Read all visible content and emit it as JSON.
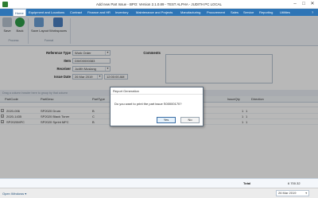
{
  "window": {
    "title": "Add new Part Issue - BPO: Version 2.1.0.89 - TEST ALPHA - JUDITH PC LOCAL",
    "minimize": "–",
    "maximize": "□",
    "close": "✕"
  },
  "menu": {
    "items": [
      "Home",
      "Equipment and Locations",
      "Contract",
      "Finance and HR",
      "Inventory",
      "Maintenance and Projects",
      "Manufacturing",
      "Procurement",
      "Sales",
      "Service",
      "Reporting",
      "Utilities"
    ],
    "help": "?"
  },
  "ribbon": {
    "save": "Save",
    "back": "Back",
    "save_layout": "Save Layout",
    "workspaces": "Workspaces",
    "group_process": "Process",
    "group_format": "Format"
  },
  "form": {
    "reference_type_label": "Reference Type",
    "reference_type_value": "Work Order",
    "item_label": "Item",
    "item_value": "DWO0000383",
    "receiver_label": "Receiver",
    "receiver_value": "Judith Muslang",
    "issue_date_label": "Issue Date",
    "issue_date_value": "26 Mar 2019",
    "issue_time_value": "12:00:00 AM",
    "comments_label": "Comments"
  },
  "grid": {
    "group_hint": "Drag a column header here to group by that column",
    "columns": [
      "PartCode",
      "PartDesc",
      "PartType",
      "IssueQty",
      "Direction"
    ],
    "rows": [
      {
        "code": "2020-006",
        "desc": "SP2020 Drum",
        "type": "B",
        "qty": "1",
        "dir": "1"
      },
      {
        "code": "2020-1435",
        "desc": "SP2020 Black Toner",
        "type": "C",
        "qty": "1",
        "dir": "1"
      },
      {
        "code": "SP2020MFC",
        "desc": "SP2020 Sprint MFC",
        "type": "B",
        "qty": "1",
        "dir": "1"
      }
    ]
  },
  "totals": {
    "label": "Total",
    "value": "6 700.32"
  },
  "status": {
    "open_windows": "Open Windows ▾",
    "date": "26 Mar 2019"
  },
  "dialog": {
    "title": "Report Generation",
    "message": "Do you want to print the part issue S00000170?",
    "yes": "Yes",
    "no": "No"
  },
  "colors": {
    "menubar": "#2e75b6",
    "ribbon_bg": "#f4f7fb",
    "overlay": "rgba(0,0,0,0.28)"
  }
}
